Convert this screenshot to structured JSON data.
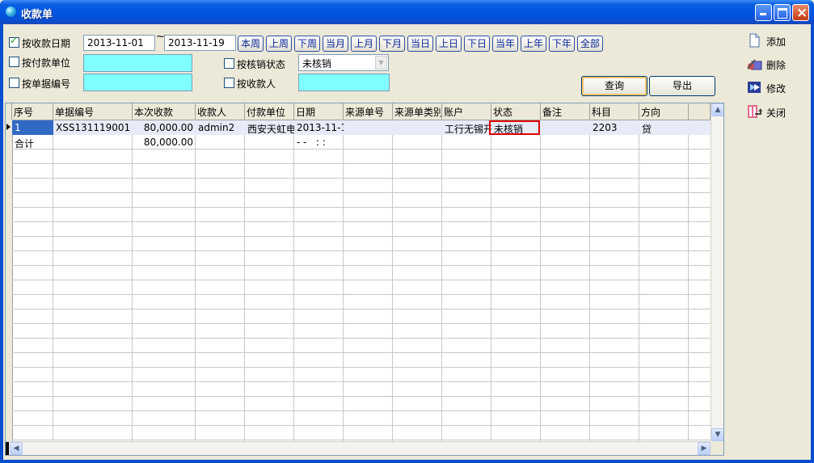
{
  "window": {
    "title": "收款单",
    "controls": {
      "minimize": "_",
      "maximize": "□",
      "close": "×"
    }
  },
  "filters": {
    "by_receipt_date": {
      "label": "按收款日期",
      "checked": true,
      "date_from": "2013-11-01",
      "date_to": "2013-11-19",
      "tilde": "~"
    },
    "by_payer_unit": {
      "label": "按付款单位",
      "checked": false,
      "value": ""
    },
    "by_doc_number": {
      "label": "按单据编号",
      "checked": false,
      "value": ""
    },
    "by_writeoff_status": {
      "label": "按核销状态",
      "checked": false,
      "value": "未核销"
    },
    "by_receiver": {
      "label": "按收款人",
      "checked": false,
      "value": ""
    }
  },
  "quick_ranges": [
    "本周",
    "上周",
    "下周",
    "当月",
    "上月",
    "下月",
    "当日",
    "上日",
    "下日",
    "当年",
    "上年",
    "下年",
    "全部"
  ],
  "buttons": {
    "query": "查询",
    "export": "导出"
  },
  "side_actions": [
    {
      "label": "添加",
      "icon": "add-document-icon"
    },
    {
      "label": "删除",
      "icon": "delete-icon"
    },
    {
      "label": "修改",
      "icon": "edit-icon"
    },
    {
      "label": "关闭",
      "icon": "close-door-icon"
    }
  ],
  "grid": {
    "columns": [
      "序号",
      "单据编号",
      "本次收款",
      "收款人",
      "付款单位",
      "日期",
      "来源单号",
      "来源单类别",
      "账户",
      "状态",
      "备注",
      "科目",
      "方向"
    ],
    "rows": [
      {
        "seq": "1",
        "doc_no": "XSS131119001",
        "amount": "80,000.00",
        "receiver": "admin2",
        "payer": "西安天虹电",
        "date": "2013-11-1",
        "src_no": "",
        "src_type": "",
        "account": "工行无锡开",
        "status": "未核销",
        "remark": "",
        "subject": "2203",
        "direction": "贷"
      }
    ],
    "total": {
      "label": "合计",
      "amount": "80,000.00",
      "date": "- -   : :"
    }
  },
  "colors": {
    "title_bar": "#0054e3",
    "cyan_field": "#80ffff",
    "highlight": "#e00000",
    "selection": "#316ac5"
  }
}
